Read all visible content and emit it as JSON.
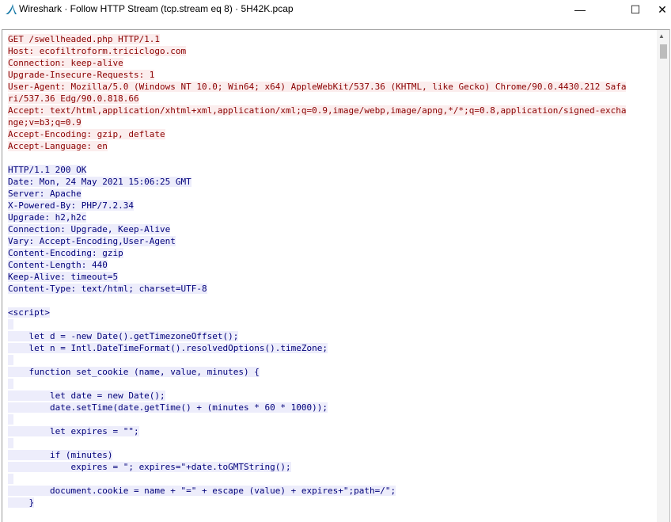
{
  "window": {
    "title": "Wireshark · Follow HTTP Stream (tcp.stream eq 8) · 5H42K.pcap",
    "controls": {
      "minimize": "—",
      "maximize": "☐",
      "close": "✕"
    }
  },
  "colors": {
    "client_fg": "#8b0000",
    "client_bg": "#fbeded",
    "server_fg": "#00007a",
    "server_bg": "#ededfb"
  },
  "stream": {
    "request": [
      "GET /swellheaded.php HTTP/1.1",
      "Host: ecofiltroform.triciclogo.com",
      "Connection: keep-alive",
      "Upgrade-Insecure-Requests: 1",
      "User-Agent: Mozilla/5.0 (Windows NT 10.0; Win64; x64) AppleWebKit/537.36 (KHTML, like Gecko) Chrome/90.0.4430.212 Safa",
      "ri/537.36 Edg/90.0.818.66",
      "Accept: text/html,application/xhtml+xml,application/xml;q=0.9,image/webp,image/apng,*/*;q=0.8,application/signed-excha",
      "nge;v=b3;q=0.9",
      "Accept-Encoding: gzip, deflate",
      "Accept-Language: en"
    ],
    "response": [
      "HTTP/1.1 200 OK",
      "Date: Mon, 24 May 2021 15:06:25 GMT",
      "Server: Apache",
      "X-Powered-By: PHP/7.2.34",
      "Upgrade: h2,h2c",
      "Connection: Upgrade, Keep-Alive",
      "Vary: Accept-Encoding,User-Agent",
      "Content-Encoding: gzip",
      "Content-Length: 440",
      "Keep-Alive: timeout=5",
      "Content-Type: text/html; charset=UTF-8"
    ],
    "body": [
      "<script>",
      "",
      "    let d = -new Date().getTimezoneOffset();",
      "    let n = Intl.DateTimeFormat().resolvedOptions().timeZone;",
      "",
      "    function set_cookie (name, value, minutes) {",
      "",
      "        let date = new Date();",
      "        date.setTime(date.getTime() + (minutes * 60 * 1000));",
      "",
      "        let expires = \"\";",
      "",
      "        if (minutes)",
      "            expires = \"; expires=\"+date.toGMTString();",
      "",
      "        document.cookie = name + \"=\" + escape (value) + expires+\";path=/\";",
      "    }"
    ]
  }
}
